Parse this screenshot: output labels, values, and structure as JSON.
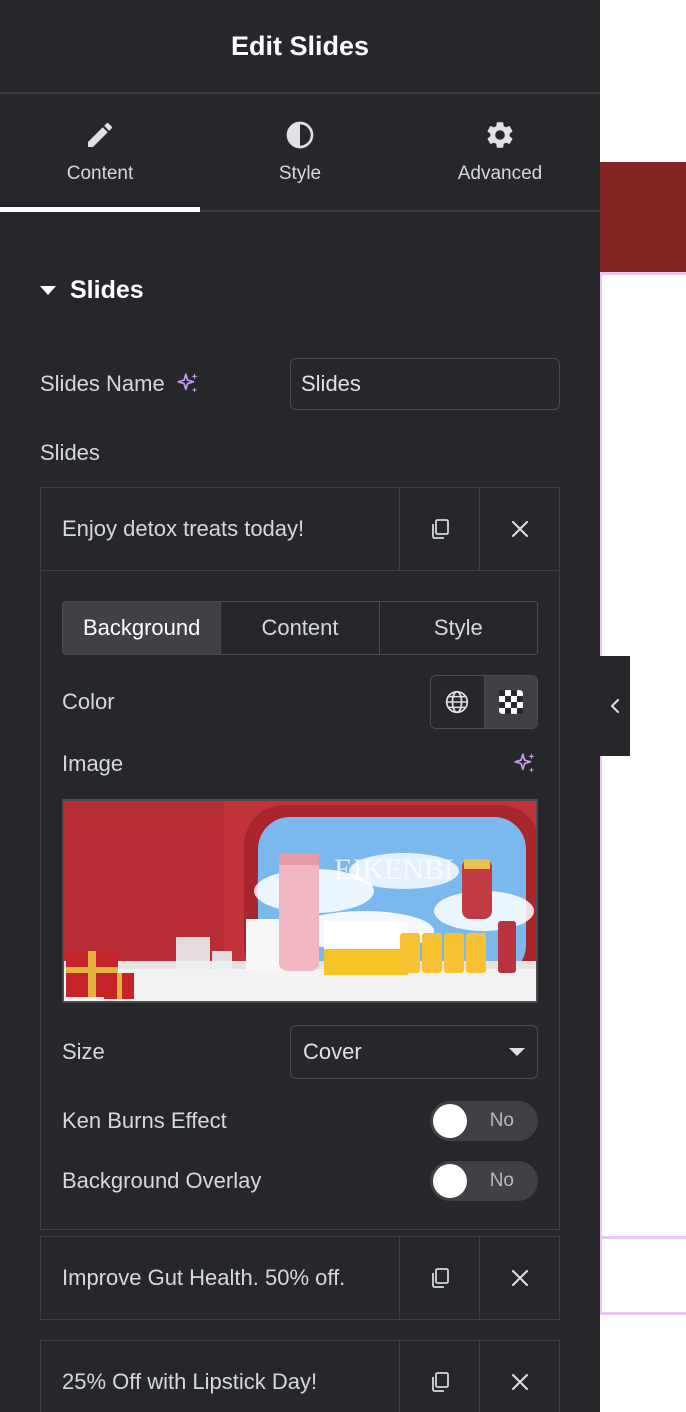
{
  "header": {
    "title": "Edit Slides"
  },
  "tabs": [
    {
      "label": "Content",
      "icon": "pencil-icon",
      "active": true
    },
    {
      "label": "Style",
      "icon": "contrast-icon",
      "active": false
    },
    {
      "label": "Advanced",
      "icon": "gear-icon",
      "active": false
    }
  ],
  "section": {
    "title": "Slides"
  },
  "slides_name": {
    "label": "Slides Name",
    "value": "Slides"
  },
  "slides_label": "Slides",
  "slides": [
    {
      "title": "Enjoy detox treats today!",
      "expanded": true,
      "sub_tabs": [
        "Background",
        "Content",
        "Style"
      ],
      "color_label": "Color",
      "image_label": "Image",
      "image_text": "EIKENBI",
      "size_label": "Size",
      "size_value": "Cover",
      "ken_burns_label": "Ken Burns Effect",
      "ken_burns_value": "No",
      "overlay_label": "Background Overlay",
      "overlay_value": "No"
    },
    {
      "title": "Improve Gut Health. 50% off.",
      "expanded": false
    },
    {
      "title": "25% Off with Lipstick Day!",
      "expanded": false
    }
  ],
  "colors": {
    "panel_bg": "#26272b",
    "ai_accent": "#c59af0",
    "preview_band": "#852526"
  }
}
